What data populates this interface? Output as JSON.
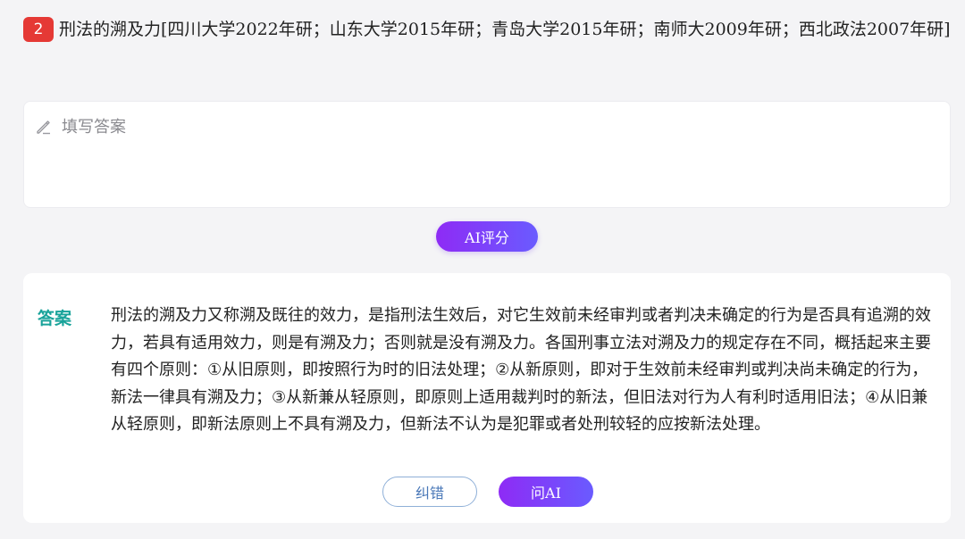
{
  "question": {
    "number": "2",
    "title": "刑法的溯及力[四川大学2022年研；山东大学2015年研；青岛大学2015年研；南师大2009年研；西北政法2007年研]"
  },
  "answer_input": {
    "placeholder": "填写答案",
    "value": ""
  },
  "ai_score_button": "AI评分",
  "answer_section": {
    "label": "答案",
    "text": "刑法的溯及力又称溯及既往的效力，是指刑法生效后，对它生效前未经审判或者判决未确定的行为是否具有追溯的效力，若具有适用效力，则是有溯及力；否则就是没有溯及力。各国刑事立法对溯及力的规定存在不同，概括起来主要有四个原则：①从旧原则，即按照行为时的旧法处理；②从新原则，即对于生效前未经审判或判决尚未确定的行为，新法一律具有溯及力；③从新兼从轻原则，即原则上适用裁判时的新法，但旧法对行为人有利时适用旧法；④从旧兼从轻原则，即新法原则上不具有溯及力，但新法不认为是犯罪或者处刑较轻的应按新法处理。",
    "correct_button": "纠错",
    "ask_ai_button": "问AI"
  },
  "colors": {
    "badge": "#e53935",
    "answer_label": "#19a39a",
    "gradient_start": "#8e2bf5",
    "gradient_end": "#6a5bff",
    "correct_border": "#8fb0d8"
  },
  "icons": {
    "input_icon": "pencil-icon"
  }
}
